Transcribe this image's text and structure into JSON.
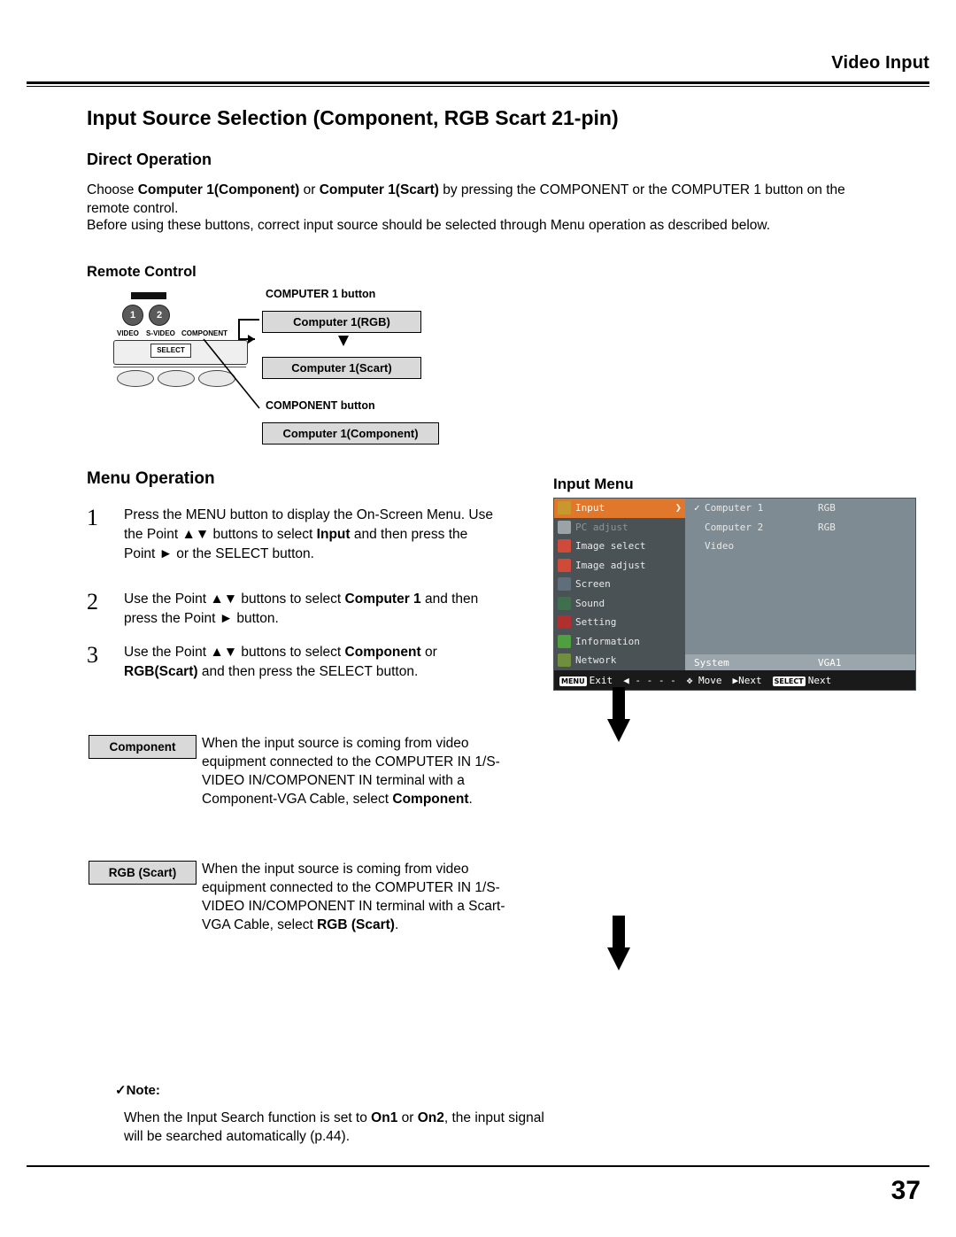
{
  "header": {
    "title": "Video Input"
  },
  "page_title": "Input Source Selection (Component, RGB Scart 21-pin)",
  "direct_operation": {
    "heading": "Direct Operation",
    "para1_a": "Choose ",
    "para1_b": "Computer 1(Component)",
    "para1_c": " or ",
    "para1_d": "Computer 1(Scart)",
    "para1_e": " by pressing the COMPONENT or the COMPUTER 1 button on the remote control.",
    "para2": "Before using these buttons, correct input source should be selected through Menu operation as described below.",
    "remote_control_heading": "Remote Control"
  },
  "remote_diagram": {
    "computer1_button_label": "COMPUTER 1 button",
    "component_button_label": "COMPONENT button",
    "tag_rgb": "Computer 1(RGB)",
    "tag_scart": "Computer 1(Scart)",
    "tag_component": "Computer 1(Component)",
    "btn1": "1",
    "btn2": "2",
    "lbl_video": "VIDEO",
    "lbl_svideo": "S-VIDEO",
    "lbl_component": "COMPONENT",
    "lbl_select": "SELECT"
  },
  "menu_operation": {
    "heading": "Menu Operation",
    "steps": [
      {
        "num": "1",
        "text_a": "Press the MENU button to display the On-Screen Menu. Use the Point ▲▼ buttons to select ",
        "bold": "Input",
        "text_b": " and then press the Point ► or the SELECT button."
      },
      {
        "num": "2",
        "text_a": "Use the Point ▲▼ buttons to select ",
        "bold": "Computer 1",
        "text_b": " and then press the Point ► button."
      },
      {
        "num": "3",
        "text_a": "Use the Point ▲▼ buttons to select ",
        "bold": "Component",
        "text_b": " or ",
        "bold2": "RGB(Scart)",
        "text_c": " and then press the SELECT button."
      }
    ],
    "definitions": [
      {
        "label": "Component",
        "text_a": "When the input source is coming from video equipment connected to the COMPUTER IN 1/S-VIDEO IN/COMPONENT IN terminal with a Component-VGA Cable, select ",
        "bold": "Component",
        "text_b": "."
      },
      {
        "label": "RGB (Scart)",
        "text_a": "When the input source is coming from video equipment connected to the COMPUTER IN 1/S-VIDEO IN/COMPONENT IN terminal with a Scart-VGA Cable, select ",
        "bold": "RGB (Scart)",
        "text_b": "."
      }
    ]
  },
  "input_menu": {
    "title": "Input Menu",
    "sidebar": [
      {
        "label": "Input",
        "selected": true,
        "color": "#c8982e"
      },
      {
        "label": "PC adjust",
        "dim": true,
        "color": "#9aa3a8"
      },
      {
        "label": "Image select",
        "color": "#d04a3a"
      },
      {
        "label": "Image adjust",
        "color": "#d04a3a"
      },
      {
        "label": "Screen",
        "color": "#5f6e78"
      },
      {
        "label": "Sound",
        "color": "#3f6f4f"
      },
      {
        "label": "Setting",
        "color": "#b03030"
      },
      {
        "label": "Information",
        "color": "#4f9f3f"
      },
      {
        "label": "Network",
        "color": "#6f8f3f"
      }
    ],
    "rows": [
      {
        "check": "✓",
        "name": "Computer 1",
        "value": "RGB"
      },
      {
        "check": "",
        "name": "Computer 2",
        "value": "RGB"
      },
      {
        "check": "",
        "name": "Video",
        "value": ""
      }
    ],
    "system_label": "System",
    "system_value": "VGA1",
    "bottom": [
      {
        "key": "MENU",
        "label": "Exit"
      },
      {
        "key": "",
        "label": "◀ - - - -"
      },
      {
        "key": "",
        "label": "✥ Move"
      },
      {
        "key": "",
        "label": "▶Next"
      },
      {
        "key": "SELECT",
        "label": "Next"
      }
    ]
  },
  "note": {
    "heading": "✓Note:",
    "text_a": "When the Input Search function is set to ",
    "bold1": "On1",
    "text_b": " or ",
    "bold2": "On2",
    "text_c": ", the input signal will be searched automatically (p.44)."
  },
  "footer": {
    "page_number": "37"
  }
}
